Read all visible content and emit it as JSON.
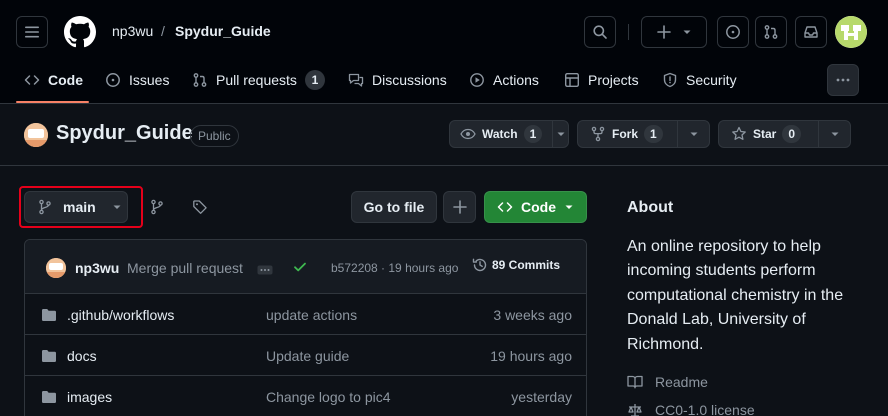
{
  "header": {
    "owner": "np3wu",
    "separator": "/",
    "repo": "Spydur_Guide"
  },
  "nav": {
    "tabs": [
      {
        "label": "Code",
        "icon": "code-icon",
        "selected": true
      },
      {
        "label": "Issues",
        "icon": "issue-icon"
      },
      {
        "label": "Pull requests",
        "icon": "pull-request-icon",
        "count": "1"
      },
      {
        "label": "Discussions",
        "icon": "discussion-icon"
      },
      {
        "label": "Actions",
        "icon": "play-icon"
      },
      {
        "label": "Projects",
        "icon": "table-icon"
      },
      {
        "label": "Security",
        "icon": "shield-icon"
      }
    ]
  },
  "repo": {
    "title": "Spydur_Guide",
    "visibility": "Public",
    "watch": {
      "label": "Watch",
      "count": "1"
    },
    "fork": {
      "label": "Fork",
      "count": "1"
    },
    "star": {
      "label": "Star",
      "count": "0"
    }
  },
  "toolbar": {
    "branch": "main",
    "go_to_file": "Go to file",
    "code_label": "Code"
  },
  "commit": {
    "author": "np3wu",
    "message": "Merge pull request",
    "hash_time": "b572208 · 19 hours ago",
    "commits_label": "89 Commits"
  },
  "files": [
    {
      "name": ".github/workflows",
      "message": "update actions",
      "time": "3 weeks ago"
    },
    {
      "name": "docs",
      "message": "Update guide",
      "time": "19 hours ago"
    },
    {
      "name": "images",
      "message": "Change logo to pic4",
      "time": "yesterday"
    }
  ],
  "about": {
    "heading": "About",
    "description": "An online repository to help incoming students perform computational chemistry in the Donald Lab, University of Richmond.",
    "readme": "Readme",
    "license": "CC0-1.0 license"
  },
  "colors": {
    "accent_green": "#238636",
    "tab_underline": "#f78166",
    "highlight_box": "#e5001a"
  }
}
